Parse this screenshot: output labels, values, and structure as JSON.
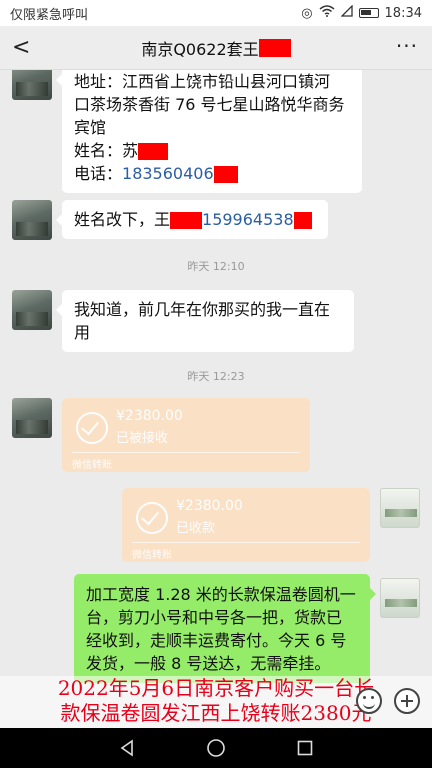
{
  "status": {
    "carrier": "仅限紧急呼叫",
    "time": "18:34"
  },
  "nav": {
    "back": "<",
    "title": "南京Q0622套王",
    "more": "···"
  },
  "messages": {
    "m1_addr_1": "地址：江西省上饶市铅山县河口镇河",
    "m1_addr_2": "口茶场茶香街 76 号七星山路悦华商务",
    "m1_addr_3": "宾馆",
    "m1_name_label": "姓名：苏",
    "m1_phone_label": "电话：",
    "m1_phone_num": "183560406",
    "m2_text": "姓名改下，王",
    "m2_num": "159964538",
    "time1": "昨天 12:10",
    "m3_line1": "我知道，前几年在你那买的我一直在",
    "m3_line2": "用",
    "time2": "昨天 12:23",
    "transfer1": {
      "amount": "¥2380.00",
      "status": "已被接收",
      "label": "微信转账"
    },
    "transfer2": {
      "amount": "¥2380.00",
      "status": "已收款",
      "label": "微信转账"
    },
    "m4_line1": "加工宽度 1.28 米的长款保温卷圆机一",
    "m4_line2": "台，剪刀小号和中号各一把，货款已",
    "m4_line3": "经收到，走顺丰运费寄付。今天 6 号",
    "m4_line4": "发货，一般 8 号送达，无需牵挂。"
  },
  "caption": {
    "line1": "2022年5月6日南京客户购买一台长",
    "line2": "款保温卷圆发江西上饶转账2380元"
  },
  "icons": {
    "emoji": "smiley-icon",
    "plus": "plus-circle-icon",
    "nav_back": "triangle-back-icon",
    "nav_home": "circle-home-icon",
    "nav_recent": "square-recent-icon"
  },
  "colors": {
    "bubble_self": "#95ec69",
    "transfer": "#fbe0c4",
    "redaction": "#ff0000",
    "caption": "#e8001b"
  }
}
